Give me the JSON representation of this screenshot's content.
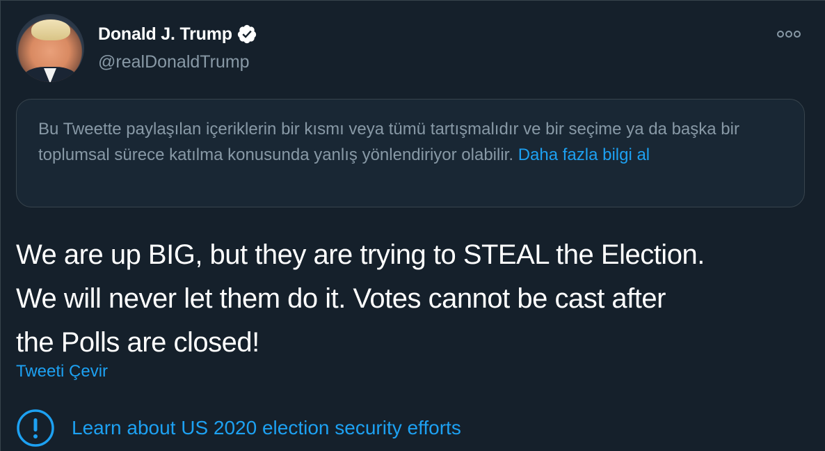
{
  "author": {
    "display_name": "Donald J. Trump",
    "handle": "@realDonaldTrump",
    "verified": true,
    "avatar_icon": "profile-photo"
  },
  "more_icon": "more-options-icon",
  "notice": {
    "text": "Bu Tweette paylaşılan içeriklerin bir kısmı veya tümü tartışmalıdır ve bir seçime ya da başka bir toplumsal sürece katılma konusunda yanlış yönlendiriyor olabilir.",
    "link": "Daha fazla bilgi al"
  },
  "tweet": {
    "line1": "We are up BIG, but they are trying to STEAL the Election.",
    "line2": "We will never let them do it. Votes cannot be cast after",
    "line3": "the Polls are closed!"
  },
  "translate_label": "Tweeti Çevir",
  "election_label": "Learn about US 2020 election security efforts",
  "colors": {
    "background": "#15202b",
    "card": "#192734",
    "border": "#38444d",
    "muted_text": "#8899a6",
    "link": "#1da1f2",
    "text": "#ffffff"
  }
}
